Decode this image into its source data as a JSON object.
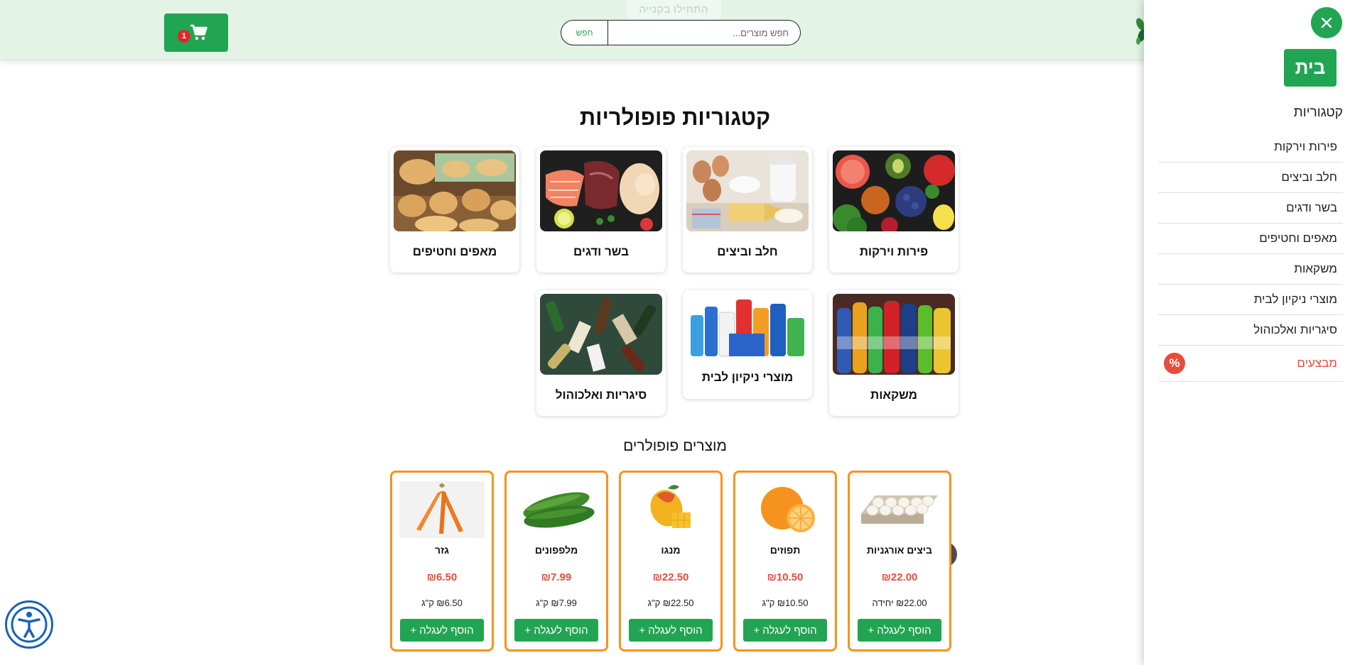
{
  "header": {
    "start_label": "התחילו בקנייה",
    "search_placeholder": "חפש מוצרים...",
    "search_button": "חפש",
    "cart_count": "1"
  },
  "categories_section": {
    "title": "קטגוריות פופולריות",
    "items": [
      {
        "label": "פירות וירקות"
      },
      {
        "label": "חלב וביצים"
      },
      {
        "label": "בשר ודגים"
      },
      {
        "label": "מאפים וחטיפים"
      },
      {
        "label": "משקאות"
      },
      {
        "label": "מוצרי ניקיון לבית"
      },
      {
        "label": "סיגריות ואלכוהול"
      }
    ]
  },
  "products_section": {
    "title": "מוצרים פופולרים",
    "items": [
      {
        "name": "ביצים אורגניות",
        "price": "₪22.00",
        "unit": "₪22.00 יחידה",
        "add_label": "הוסף לעגלה +"
      },
      {
        "name": "תפוזים",
        "price": "₪10.50",
        "unit": "₪10.50 ק\"ג",
        "add_label": "הוסף לעגלה +"
      },
      {
        "name": "מנגו",
        "price": "₪22.50",
        "unit": "₪22.50 ק\"ג",
        "add_label": "הוסף לעגלה +"
      },
      {
        "name": "מלפפונים",
        "price": "₪7.99",
        "unit": "₪7.99 ק\"ג",
        "add_label": "הוסף לעגלה +"
      },
      {
        "name": "גזר",
        "price": "₪6.50",
        "unit": "₪6.50 ק\"ג",
        "add_label": "הוסף לעגלה +"
      }
    ]
  },
  "sidebar": {
    "home_label": "בית",
    "categories_heading": "קטגוריות",
    "items": [
      {
        "label": "פירות וירקות"
      },
      {
        "label": "חלב וביצים"
      },
      {
        "label": "בשר ודגים"
      },
      {
        "label": "מאפים וחטיפים"
      },
      {
        "label": "משקאות"
      },
      {
        "label": "מוצרי ניקיון לבית"
      },
      {
        "label": "סיגריות ואלכוהול"
      }
    ],
    "promo_label": "מבצעים",
    "promo_icon": "%"
  },
  "colors": {
    "brand_green": "#22a552",
    "header_bg": "#e3f4e6",
    "product_border": "#f7931e",
    "price_red": "#e74c3c",
    "badge_red": "#e3262d"
  }
}
